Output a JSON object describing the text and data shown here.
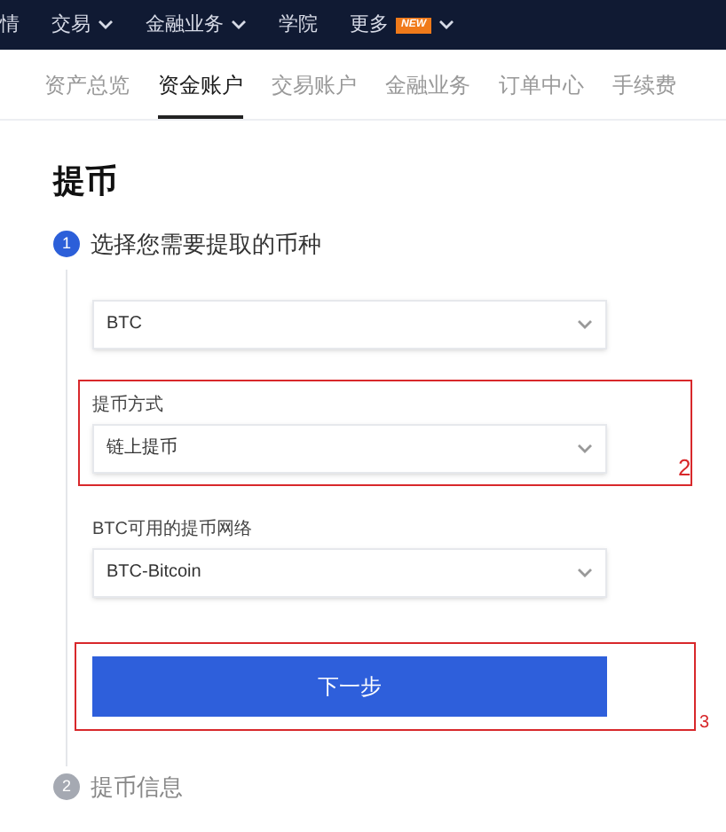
{
  "nav": [
    {
      "label": "情",
      "caret": false
    },
    {
      "label": "交易",
      "caret": true
    },
    {
      "label": "金融业务",
      "caret": true
    },
    {
      "label": "学院",
      "caret": false
    },
    {
      "label": "更多",
      "caret": true,
      "badge": "NEW"
    }
  ],
  "tabs": [
    {
      "label": "资产总览",
      "selected": false
    },
    {
      "label": "资金账户",
      "selected": true
    },
    {
      "label": "交易账户",
      "selected": false
    },
    {
      "label": "金融业务",
      "selected": false
    },
    {
      "label": "订单中心",
      "selected": false
    },
    {
      "label": "手续费",
      "selected": false
    }
  ],
  "title": "提币",
  "steps": [
    {
      "number": "1",
      "label": "选择您需要提取的币种",
      "active": true
    },
    {
      "number": "2",
      "label": "提币信息",
      "active": false
    }
  ],
  "fields": [
    {
      "value": "BTC",
      "highlighted": false
    },
    {
      "label": "提币方式",
      "value": "链上提币",
      "highlighted": true,
      "annotation": "2"
    },
    {
      "label": "BTC可用的提币网络",
      "value": "BTC-Bitcoin",
      "highlighted": false
    }
  ],
  "next_button": {
    "label": "下一步",
    "highlighted": true,
    "annotation": "3"
  }
}
